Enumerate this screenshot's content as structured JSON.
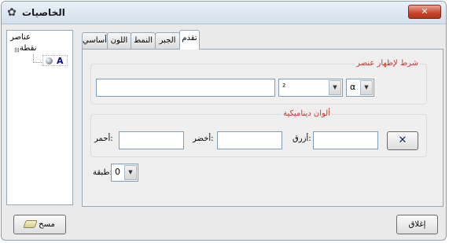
{
  "window": {
    "title": "الخاصيات",
    "close_label": "✕"
  },
  "tree": {
    "root": "عناصر",
    "node": "نقطة",
    "toggle": "⊟",
    "leaf": "A"
  },
  "tabs": [
    {
      "label": "أساسي"
    },
    {
      "label": "اللون"
    },
    {
      "label": "النمط"
    },
    {
      "label": "الجبر"
    },
    {
      "label": "تقدم"
    }
  ],
  "active_tab": "تقدم",
  "condition": {
    "group_label": "شرط لإظهار عنصر",
    "input_value": "",
    "combo1_value": "²",
    "combo2_value": "α"
  },
  "dynamic_colors": {
    "group_label": "ألوان ديناميكية",
    "red_label": "أحمر:",
    "green_label": "أخضر:",
    "blue_label": "أزرق:",
    "red_value": "",
    "green_value": "",
    "blue_value": "",
    "clear_label": "✕"
  },
  "layer": {
    "label": "طبقة:",
    "value": "0"
  },
  "buttons": {
    "delete_label": "مسح",
    "close_label": "إغلاق"
  },
  "icons": {
    "title": "gear-icon",
    "close": "close-icon",
    "sphere": "point-sphere-icon",
    "eraser": "eraser-icon",
    "combo_arrow": "chevron-down-icon"
  }
}
